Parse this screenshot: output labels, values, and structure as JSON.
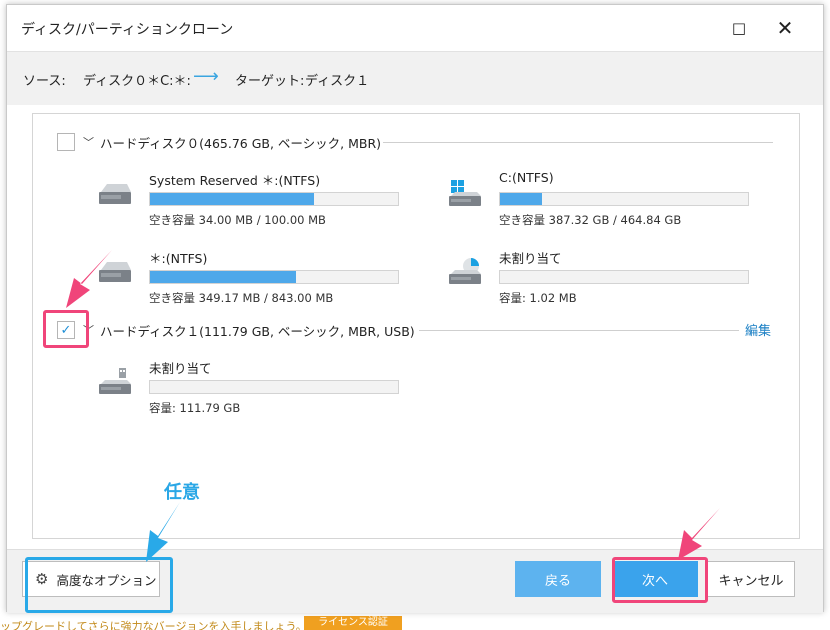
{
  "window": {
    "title": "ディスク/パーティションクローン",
    "maximize_icon": "□",
    "close_icon": "✕"
  },
  "info": {
    "source_label": "ソース:",
    "source_value": "ディスク０＊C:＊:",
    "target_label": "ターゲット:",
    "target_value": "ディスク１"
  },
  "disks": [
    {
      "checked": false,
      "title": "ハードディスク０(465.76 GB, ベーシック, MBR)",
      "partitions": [
        {
          "name": "System Reserved ＊:(NTFS)",
          "capacity": "空き容量 34.00 MB / 100.00 MB",
          "fill": 0.66,
          "icon": "drive-icon"
        },
        {
          "name": "C:(NTFS)",
          "capacity": "空き容量 387.32 GB / 464.84 GB",
          "fill": 0.17,
          "icon": "windows-drive-icon"
        },
        {
          "name": "＊:(NTFS)",
          "capacity": "空き容量 349.17 MB / 843.00 MB",
          "fill": 0.59,
          "icon": "drive-icon"
        },
        {
          "name": "未割り当て",
          "capacity": "容量: 1.02 MB",
          "fill": 0.0,
          "icon": "unallocated-drive-icon"
        }
      ]
    },
    {
      "checked": true,
      "title": "ハードディスク１(111.79 GB, ベーシック, MBR, USB)",
      "edit_label": "編集",
      "partitions": [
        {
          "name": "未割り当て",
          "capacity": "容量: 111.79 GB",
          "fill": 0.0,
          "icon": "usb-drive-icon"
        }
      ]
    }
  ],
  "footer": {
    "advanced_label": "高度なオプション",
    "back_label": "戻る",
    "next_label": "次へ",
    "cancel_label": "キャンセル"
  },
  "annotation": {
    "optional_label": "任意"
  },
  "background": {
    "promo_text": "ップグレードしてさらに強力なバージョンを入手しましょう。",
    "license_button": "ライセンス認証"
  },
  "colors": {
    "accent": "#3aa3ec",
    "bar_fill": "#4ea8ea",
    "highlight_pink": "#f0457a",
    "highlight_blue": "#29a9e8"
  }
}
